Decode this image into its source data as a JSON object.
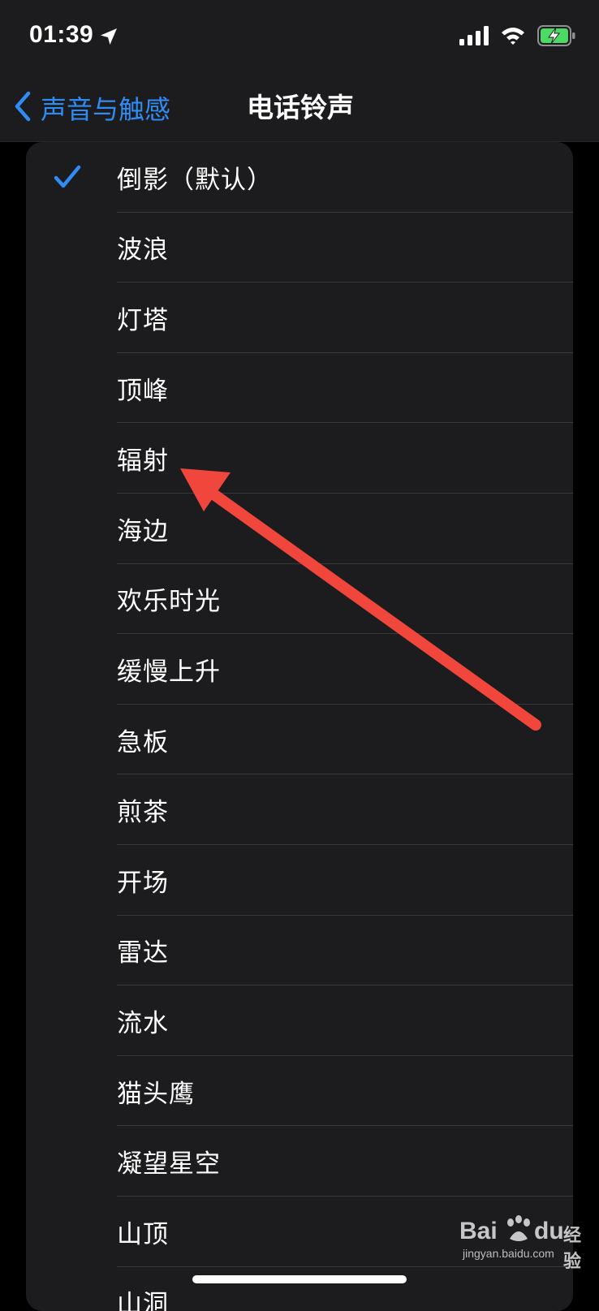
{
  "status_bar": {
    "time": "01:39",
    "icons": [
      "location-arrow-icon",
      "cellular-signal-icon",
      "wifi-icon",
      "battery-charging-icon"
    ]
  },
  "nav": {
    "back_label": "声音与触感",
    "title": "电话铃声"
  },
  "ringtones": [
    {
      "label": "倒影（默认）",
      "selected": true
    },
    {
      "label": "波浪",
      "selected": false
    },
    {
      "label": "灯塔",
      "selected": false
    },
    {
      "label": "顶峰",
      "selected": false
    },
    {
      "label": "辐射",
      "selected": false
    },
    {
      "label": "海边",
      "selected": false
    },
    {
      "label": "欢乐时光",
      "selected": false
    },
    {
      "label": "缓慢上升",
      "selected": false
    },
    {
      "label": "急板",
      "selected": false
    },
    {
      "label": "煎茶",
      "selected": false
    },
    {
      "label": "开场",
      "selected": false
    },
    {
      "label": "雷达",
      "selected": false
    },
    {
      "label": "流水",
      "selected": false
    },
    {
      "label": "猫头鹰",
      "selected": false
    },
    {
      "label": "凝望星空",
      "selected": false
    },
    {
      "label": "山顶",
      "selected": false
    },
    {
      "label": "山洞",
      "selected": false
    }
  ],
  "watermark": {
    "bai": "Bai",
    "du": "du",
    "jingyan": "经验",
    "url": "jingyan.baidu.com"
  },
  "colors": {
    "accent": "#2f8cf5",
    "annotation": "#f0463c",
    "cell_background": "#1c1c1e",
    "page_background": "#000000"
  }
}
